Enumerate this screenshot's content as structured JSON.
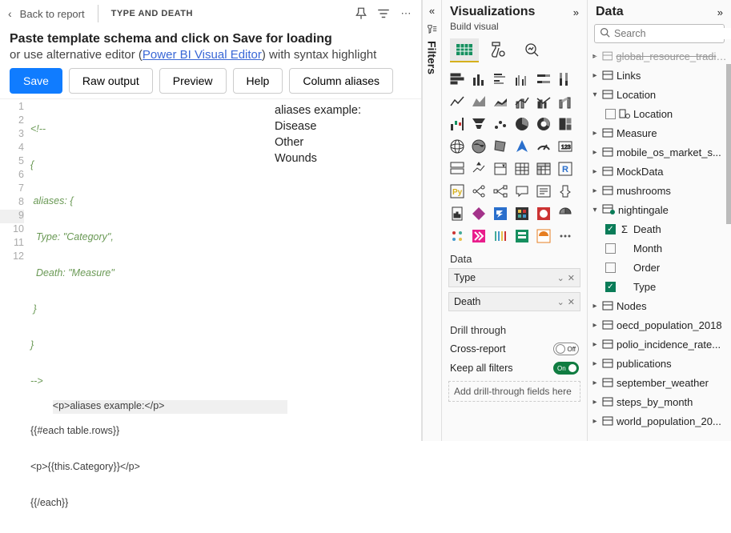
{
  "topbar": {
    "back_label": "Back to report",
    "breadcrumb": "TYPE AND DEATH"
  },
  "content": {
    "heading1": "Paste template schema and click on Save for loading",
    "heading2_pre": "or use alternative editor (",
    "heading2_link": "Power BI Visual Editor",
    "heading2_post": ") with syntax highlight"
  },
  "buttons": {
    "save": "Save",
    "raw": "Raw output",
    "preview": "Preview",
    "help": "Help",
    "aliases": "Column aliases"
  },
  "code": {
    "l1": "<!--",
    "l2": "{",
    "l3": " aliases: {",
    "l4": "  Type: \"Category\",",
    "l5": "  Death: \"Measure\"",
    "l6": " }",
    "l7": "}",
    "l8": "-->",
    "l9": "<p>aliases example:</p>",
    "l10": "{{#each table.rows}}",
    "l11": "<p>{{this.Category}}</p>",
    "l12": "{{/each}}"
  },
  "preview": {
    "p1": "aliases example:",
    "p2": "Disease",
    "p3": "Other",
    "p4": "Wounds"
  },
  "filters": {
    "label": "Filters"
  },
  "viz": {
    "title": "Visualizations",
    "sub": "Build visual",
    "data_label": "Data",
    "field1": "Type",
    "field2": "Death",
    "drill_label": "Drill through",
    "cross": "Cross-report",
    "off": "Off",
    "keep": "Keep all filters",
    "on": "On",
    "placeholder": "Add drill-through fields here"
  },
  "data": {
    "title": "Data",
    "search_placeholder": "Search",
    "tables": {
      "t0": "global_resource_tradin...",
      "t1": "Links",
      "t2": "Location",
      "t2c": "Location",
      "t3": "Measure",
      "t4": "mobile_os_market_s...",
      "t5": "MockData",
      "t6": "mushrooms",
      "t7": "nightingale",
      "t7a": "Death",
      "t7b": "Month",
      "t7c": "Order",
      "t7d": "Type",
      "t8": "Nodes",
      "t9": "oecd_population_2018",
      "t10": "polio_incidence_rate...",
      "t11": "publications",
      "t12": "september_weather",
      "t13": "steps_by_month",
      "t14": "world_population_20..."
    }
  }
}
